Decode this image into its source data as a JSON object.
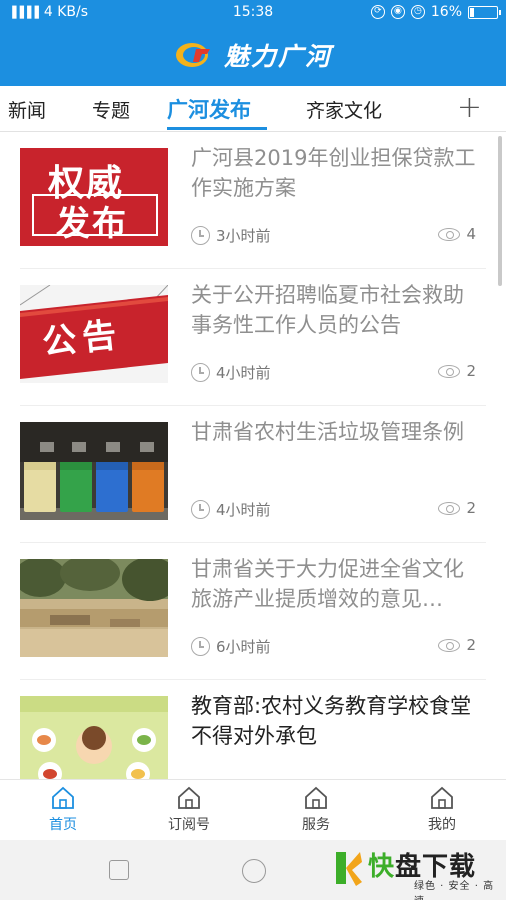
{
  "status_bar": {
    "signal": "▐▐▐▐",
    "speed": "4 KB/s",
    "time": "15:38",
    "battery": "16%",
    "battery_level": 0.16,
    "icons": [
      "signal-icon",
      "rotation-icon",
      "vpn-icon",
      "alarm-icon",
      "wifi-icon",
      "battery-icon"
    ]
  },
  "app_bar": {
    "title": "魅力广河",
    "logo": "guanghe-logo"
  },
  "tabs": {
    "items": [
      {
        "label": "新闻"
      },
      {
        "label": "专题"
      },
      {
        "label": "广河发布",
        "active": true
      },
      {
        "label": "齐家文化"
      }
    ],
    "add_icon": "+"
  },
  "feed": [
    {
      "title": "广河县2019年创业担保贷款工作实施方案",
      "time": "3小时前",
      "views": "4",
      "thumb": "权威发布",
      "thumb_line1": "权威",
      "thumb_line2": "发布",
      "read": true
    },
    {
      "title": "关于公开招聘临夏市社会救助事务性工作人员的公告",
      "time": "4小时前",
      "views": "2",
      "thumb": "公告",
      "read": true
    },
    {
      "title": "甘肃省农村生活垃圾管理条例",
      "time": "4小时前",
      "views": "2",
      "thumb": "garbage-bins",
      "read": true
    },
    {
      "title": "甘肃省关于大力促进全省文化旅游产业提质增效的意见…",
      "time": "6小时前",
      "views": "2",
      "thumb": "excavation-site",
      "read": true
    },
    {
      "title": "教育部:农村义务教育学校食堂不得对外承包",
      "time": "",
      "views": "",
      "thumb": "cafeteria-poster",
      "read": false
    }
  ],
  "bottom_nav": [
    {
      "label": "首页",
      "active": true
    },
    {
      "label": "订阅号"
    },
    {
      "label": "服务"
    },
    {
      "label": "我的"
    }
  ],
  "watermark": {
    "main_green": "快",
    "main_rest": "盘下载",
    "sub": "绿色 · 安全 · 高速"
  },
  "colors": {
    "primary": "#1c8fe0",
    "read_title": "#8f8f8f",
    "red_banner": "#c8232c"
  }
}
